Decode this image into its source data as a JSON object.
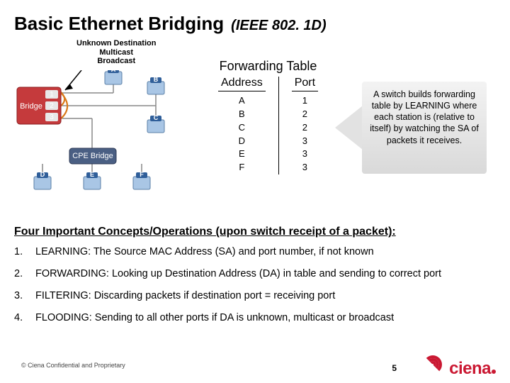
{
  "title": "Basic Ethernet Bridging",
  "subtitle": "(IEEE 802. 1D)",
  "annotation": {
    "l1": "Unknown Destination",
    "l2": "Multicast",
    "l3": "Broadcast"
  },
  "forwarding_table": {
    "title": "Forwarding Table",
    "head_addr": "Address",
    "head_port": "Port",
    "rows": [
      {
        "addr": "A",
        "port": "1"
      },
      {
        "addr": "B",
        "port": "2"
      },
      {
        "addr": "C",
        "port": "2"
      },
      {
        "addr": "D",
        "port": "3"
      },
      {
        "addr": "E",
        "port": "3"
      },
      {
        "addr": "F",
        "port": "3"
      }
    ]
  },
  "arrow_note": "A  switch builds forwarding table by LEARNING where each station is (relative to itself) by watching the SA of packets it receives.",
  "concepts_title": "Four Important Concepts/Operations (upon switch receipt of a packet):",
  "concepts": [
    {
      "n": "1.",
      "text": "LEARNING: The Source MAC Address (SA) and port number, if not known"
    },
    {
      "n": "2.",
      "text": "FORWARDING:  Looking up Destination Address (DA) in table and sending to correct port"
    },
    {
      "n": "3.",
      "text": "FILTERING:  Discarding packets if destination port = receiving port"
    },
    {
      "n": "4.",
      "text": "FLOODING:   Sending to all other ports if DA is unknown, multicast or broadcast"
    }
  ],
  "footer": "© Ciena Confidential and Proprietary",
  "page": "5",
  "logo_text": "ciena",
  "diagram": {
    "bridge_label": "Bridge",
    "cpe_label": "CPE Bridge",
    "ports": {
      "p1": "1",
      "p2": "2",
      "p3": "3"
    },
    "stations": {
      "a": "A",
      "b": "B",
      "c": "C",
      "d": "D",
      "e": "E",
      "f": "F"
    }
  }
}
